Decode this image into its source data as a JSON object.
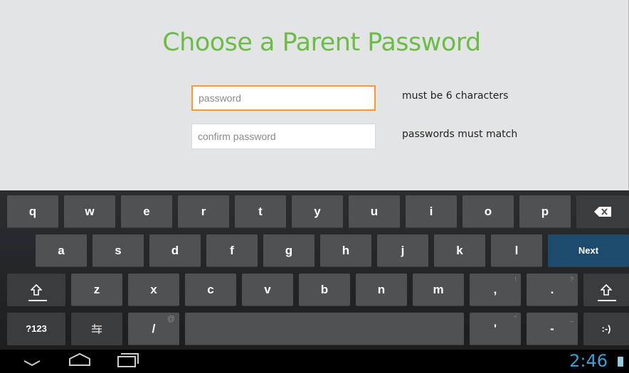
{
  "title": "Choose a Parent Password",
  "fields": {
    "password_placeholder": "password",
    "confirm_placeholder": "confirm password"
  },
  "hints": {
    "password": "must be 6 characters",
    "confirm": "passwords must match"
  },
  "keyboard": {
    "row1": [
      "q",
      "w",
      "e",
      "r",
      "t",
      "y",
      "u",
      "i",
      "o",
      "p"
    ],
    "row2": [
      "a",
      "s",
      "d",
      "f",
      "g",
      "h",
      "j",
      "k",
      "l"
    ],
    "row3": [
      "z",
      "x",
      "c",
      "v",
      "b",
      "n",
      "m"
    ],
    "next": "Next",
    "sym": "?123",
    "slash": "/",
    "slash_alt": "@",
    "comma": ",",
    "comma_alt": "!",
    "period": ".",
    "period_alt": "?",
    "apostrophe": "'",
    "apostrophe_alt": "\"",
    "dash": "-",
    "dash_alt": "_",
    "smiley": ":-)"
  },
  "status": {
    "time": "2:46"
  },
  "colors": {
    "title": "#6cbd45",
    "focus": "#f49a32",
    "next_key": "#1c4b6e",
    "clock": "#3aa1d4"
  },
  "icons": [
    "backspace-icon",
    "shift-icon",
    "settings-icon",
    "back-icon",
    "home-icon",
    "recent-apps-icon",
    "battery-icon"
  ]
}
